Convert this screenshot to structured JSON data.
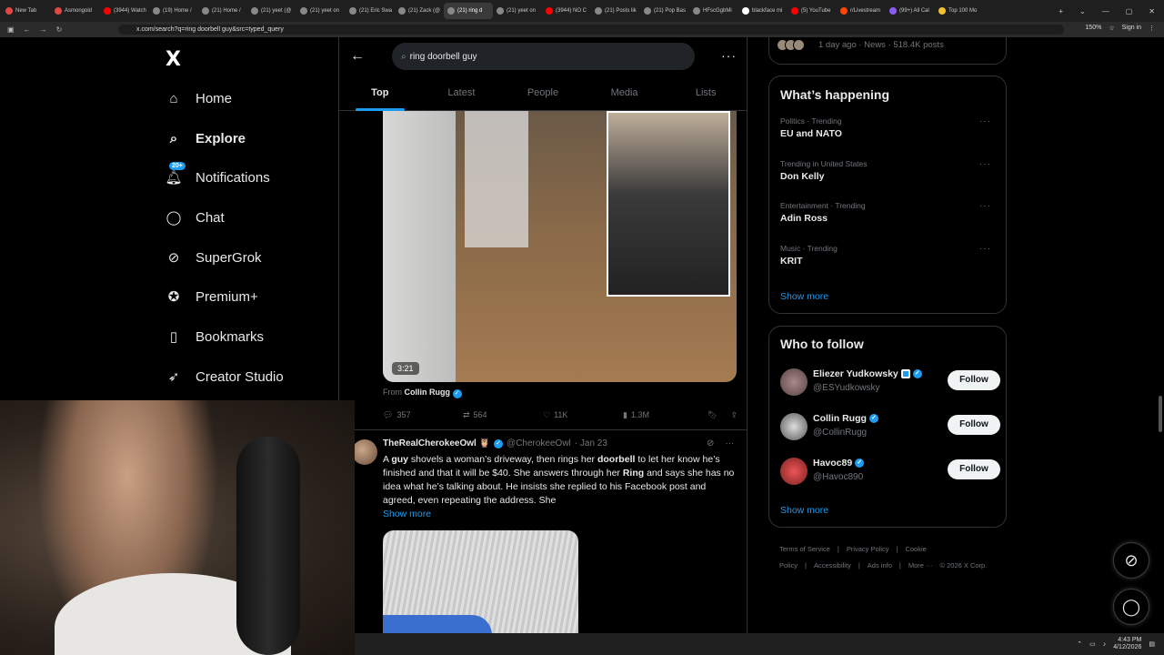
{
  "browser": {
    "tabs": [
      {
        "label": "New Tab",
        "color": "#e04848"
      },
      {
        "label": "Asmongold",
        "color": "#e04848"
      },
      {
        "label": "(3944) Watch",
        "color": "#ff0000"
      },
      {
        "label": "(19) Home /",
        "color": "#888888"
      },
      {
        "label": "(21) Home /",
        "color": "#888888"
      },
      {
        "label": "(21) yeet (@",
        "color": "#888888"
      },
      {
        "label": "(21) yeet on",
        "color": "#888888"
      },
      {
        "label": "(21) Eric Swa",
        "color": "#888888"
      },
      {
        "label": "(21) Zack (@",
        "color": "#888888"
      },
      {
        "label": "(21) ring d",
        "color": "#888888",
        "active": true
      },
      {
        "label": "(21) yeet on",
        "color": "#888888"
      },
      {
        "label": "(3944) NO C",
        "color": "#ff0000"
      },
      {
        "label": "(21) Posts lik",
        "color": "#888888"
      },
      {
        "label": "(21) Pop Bas",
        "color": "#888888"
      },
      {
        "label": "HFscGgbMi",
        "color": "#888888"
      },
      {
        "label": "blackface mi",
        "color": "#ffffff"
      },
      {
        "label": "(5) YouTube",
        "color": "#ff0000"
      },
      {
        "label": "r/Livestream",
        "color": "#ff4500"
      },
      {
        "label": "(99+) All Cal",
        "color": "#8a5cf6"
      },
      {
        "label": "Top 100 Mo",
        "color": "#f2c12e"
      }
    ],
    "url": "x.com/search?q=ring doorbell guy&src=typed_query",
    "zoom": "150%",
    "sign_in": "Sign in"
  },
  "nav": {
    "logo": "X",
    "items": [
      {
        "label": "Home",
        "icon": "home-icon"
      },
      {
        "label": "Explore",
        "icon": "search-icon",
        "bold": true
      },
      {
        "label": "Notifications",
        "icon": "bell-icon",
        "badge": "20+"
      },
      {
        "label": "Chat",
        "icon": "chat-icon"
      },
      {
        "label": "SuperGrok",
        "icon": "grok-icon"
      },
      {
        "label": "Premium+",
        "icon": "premium-icon"
      },
      {
        "label": "Bookmarks",
        "icon": "bookmark-icon"
      },
      {
        "label": "Creator Studio",
        "icon": "rocket-icon"
      }
    ]
  },
  "search": {
    "query": "ring doorbell guy",
    "tabs": [
      "Top",
      "Latest",
      "People",
      "Media",
      "Lists"
    ],
    "selected_tab": "Top"
  },
  "post1": {
    "video_time": "3:21",
    "from_label": "From",
    "from_name": "Collin Rugg",
    "replies": "357",
    "reposts": "564",
    "likes": "11K",
    "views": "1.3M"
  },
  "post2": {
    "name": "TheRealCherokeeOwl 🦉",
    "handle": "@CherokeeOwl",
    "date": "· Jan 23",
    "body_html": "A <b>guy</b> shovels a woman’s driveway, then rings her <b>doorbell</b> to let her know he’s finished and that it will be $40. She answers through her <b>Ring</b> and says she has no idea what he’s talking about. He insists she replied to his Facebook post and agreed, even repeating the address. She",
    "show_more": "Show more"
  },
  "right": {
    "top_card": "1 day ago · News · 518.4K posts",
    "happening_title": "What’s happening",
    "trends": [
      {
        "category": "Politics · Trending",
        "title": "EU and NATO"
      },
      {
        "category": "Trending in United States",
        "title": "Don Kelly"
      },
      {
        "category": "Entertainment · Trending",
        "title": "Adin Ross"
      },
      {
        "category": "Music · Trending",
        "title": "KRIT"
      }
    ],
    "show_more": "Show more",
    "wtf_title": "Who to follow",
    "follow": [
      {
        "name": "Eliezer Yudkowsky",
        "handle": "@ESYudkowsky",
        "button": "Follow"
      },
      {
        "name": "Collin Rugg",
        "handle": "@CollinRugg",
        "button": "Follow"
      },
      {
        "name": "Havoc89",
        "handle": "@Havoc890",
        "button": "Follow"
      }
    ],
    "wtf_show_more": "Show more",
    "footer": [
      "Terms of Service",
      "|",
      "Privacy Policy",
      "|",
      "Cookie Policy",
      "|",
      "Accessibility",
      "|",
      "Ads info",
      "|",
      "More ···",
      "© 2026 X Corp."
    ]
  },
  "taskbar": {
    "time": "4:43 PM",
    "date": "4/12/2026"
  },
  "colors": {
    "accent": "#1d9bf0",
    "background": "#000000",
    "border": "#2f3336"
  }
}
